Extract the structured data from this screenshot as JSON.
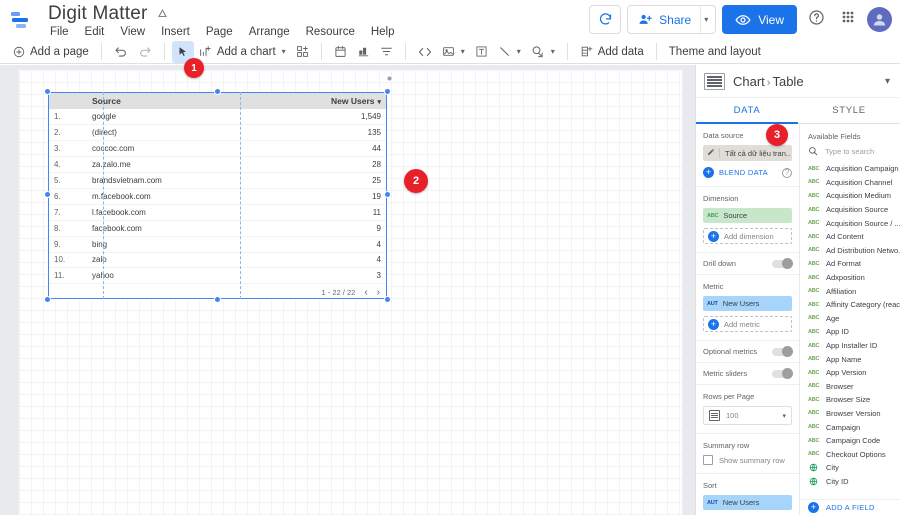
{
  "header": {
    "doc_title": "Digit Matter",
    "drive_icon": "drive-icon",
    "menus": [
      "File",
      "Edit",
      "View",
      "Insert",
      "Page",
      "Arrange",
      "Resource",
      "Help"
    ],
    "refresh_label": "refresh-icon",
    "share_label": "Share",
    "view_label": "View",
    "help_label": "help-icon",
    "apps_label": "apps-grid-icon",
    "avatar_label": "user-avatar"
  },
  "toolbar": {
    "add_page": "Add a page",
    "undo": "undo-icon",
    "redo": "redo-icon",
    "select": "cursor-icon",
    "add_chart": "Add a chart",
    "add_control": "add-control-icon",
    "date_range": "date-range-icon",
    "bar_chart": "bar-chart-icon",
    "filter": "filter-icon",
    "embed": "embed-code-icon",
    "image": "image-icon",
    "text": "text-box-icon",
    "line": "line-icon",
    "shape": "shape-icon",
    "add_data": "Add data",
    "theme_layout": "Theme and layout"
  },
  "badges": [
    {
      "id": "1",
      "number": "1"
    },
    {
      "id": "2",
      "number": "2"
    },
    {
      "id": "3",
      "number": "3"
    }
  ],
  "table": {
    "columns": [
      "Source",
      "New Users"
    ],
    "sort_caret": "▾",
    "rows": [
      {
        "idx": "1.",
        "source": "google",
        "new_users": "1,549"
      },
      {
        "idx": "2.",
        "source": "(direct)",
        "new_users": "135"
      },
      {
        "idx": "3.",
        "source": "coccoc.com",
        "new_users": "44"
      },
      {
        "idx": "4.",
        "source": "za.zalo.me",
        "new_users": "28"
      },
      {
        "idx": "5.",
        "source": "brandsvietnam.com",
        "new_users": "25"
      },
      {
        "idx": "6.",
        "source": "m.facebook.com",
        "new_users": "19"
      },
      {
        "idx": "7.",
        "source": "l.facebook.com",
        "new_users": "11"
      },
      {
        "idx": "8.",
        "source": "facebook.com",
        "new_users": "9"
      },
      {
        "idx": "9.",
        "source": "bing",
        "new_users": "4"
      },
      {
        "idx": "10.",
        "source": "zalo",
        "new_users": "4"
      },
      {
        "idx": "11.",
        "source": "yahoo",
        "new_users": "3"
      }
    ],
    "pagination": "1 - 22 / 22",
    "prev_icon": "‹",
    "next_icon": "›"
  },
  "panel": {
    "chart_type_icon": "table-chart-icon",
    "breadcrumb_root": "Chart",
    "breadcrumb_sep": "›",
    "breadcrumb_leaf": "Table",
    "collapse_icon": "chevron-down-icon",
    "tabs": [
      {
        "label": "DATA",
        "active": true
      },
      {
        "label": "STYLE",
        "active": false
      }
    ],
    "data_source": {
      "section_label": "Data source",
      "source_name": "Tất cả dữ liệu tran..",
      "edit_icon": "pencil-icon",
      "blend_label": "BLEND DATA",
      "help_icon": "question-icon"
    },
    "dimension": {
      "section_label": "Dimension",
      "chip_tag": "ABC",
      "chip_label": "Source",
      "add_label": "Add dimension"
    },
    "drill_down": {
      "label": "Drill down",
      "on": false
    },
    "metric": {
      "section_label": "Metric",
      "chip_tag": "AUT",
      "chip_label": "New Users",
      "add_label": "Add metric"
    },
    "optional_metrics": {
      "label": "Optional metrics",
      "on": false
    },
    "metric_sliders": {
      "label": "Metric sliders",
      "on": false
    },
    "rows_per_page": {
      "section_label": "Rows per Page",
      "value": "100",
      "icon": "rows-icon",
      "caret": "▾"
    },
    "summary_row": {
      "section_label": "Summary row",
      "checkbox_label": "Show summary row",
      "checked": false
    },
    "sort": {
      "section_label": "Sort",
      "chip_tag": "AUT",
      "chip_label": "New Users"
    },
    "available_fields": {
      "header": "Available Fields",
      "search_icon": "search-icon",
      "search_placeholder": "Type to search",
      "add_field_label": "ADD A FIELD",
      "fields": [
        {
          "name": "Acquisition Campaign",
          "type": "ABC"
        },
        {
          "name": "Acquisition Channel",
          "type": "ABC"
        },
        {
          "name": "Acquisition Medium",
          "type": "ABC"
        },
        {
          "name": "Acquisition Source",
          "type": "ABC"
        },
        {
          "name": "Acquisition Source / ...",
          "type": "ABC"
        },
        {
          "name": "Ad Content",
          "type": "ABC"
        },
        {
          "name": "Ad Distribution Netwo..",
          "type": "ABC"
        },
        {
          "name": "Ad Format",
          "type": "ABC"
        },
        {
          "name": "Adxposition",
          "type": "ABC"
        },
        {
          "name": "Affiliation",
          "type": "ABC"
        },
        {
          "name": "Affinity Category (reac..",
          "type": "ABC"
        },
        {
          "name": "Age",
          "type": "ABC"
        },
        {
          "name": "App ID",
          "type": "ABC"
        },
        {
          "name": "App Installer ID",
          "type": "ABC"
        },
        {
          "name": "App Name",
          "type": "ABC"
        },
        {
          "name": "App Version",
          "type": "ABC"
        },
        {
          "name": "Browser",
          "type": "ABC"
        },
        {
          "name": "Browser Size",
          "type": "ABC"
        },
        {
          "name": "Browser Version",
          "type": "ABC"
        },
        {
          "name": "Campaign",
          "type": "ABC"
        },
        {
          "name": "Campaign Code",
          "type": "ABC"
        },
        {
          "name": "Checkout Options",
          "type": "ABC"
        },
        {
          "name": "City",
          "type": "GEO"
        },
        {
          "name": "City ID",
          "type": "GEO"
        }
      ]
    }
  },
  "colors": {
    "accent": "#1a73e8",
    "badge": "#e8202a",
    "dimension_chip": "#c8e6c9",
    "metric_chip": "#a6d4fa",
    "canvas_bg": "#e8eaed"
  }
}
